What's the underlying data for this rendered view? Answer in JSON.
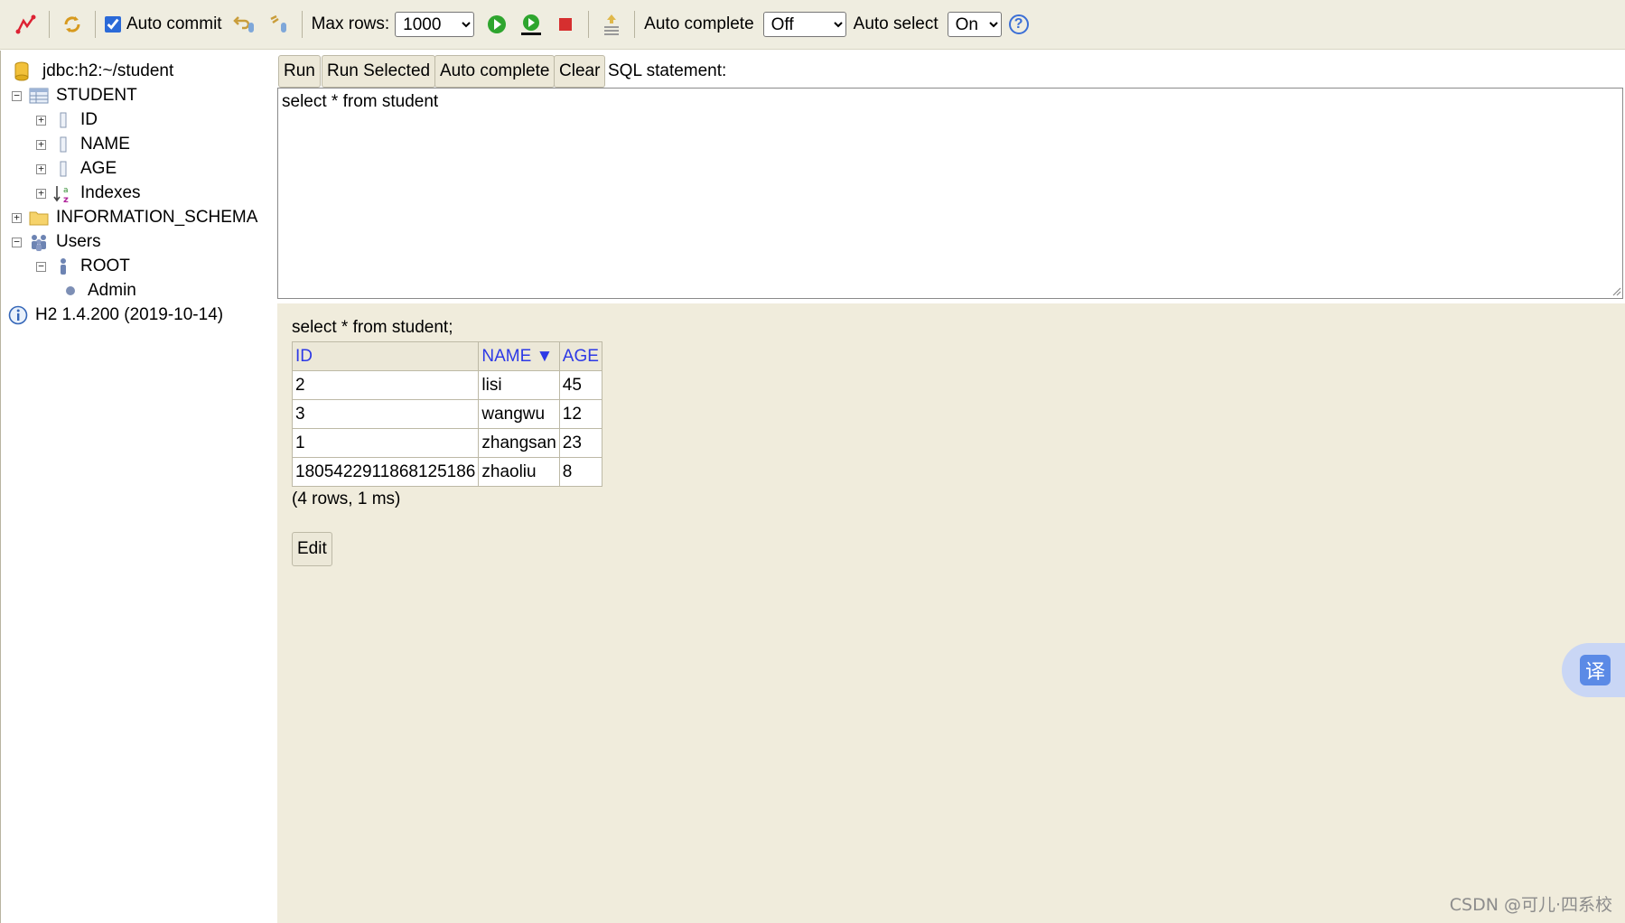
{
  "toolbar": {
    "auto_commit_label": "Auto commit",
    "auto_commit_checked": true,
    "max_rows_label": "Max rows:",
    "max_rows_value": "1000",
    "auto_complete_label": "Auto complete",
    "auto_complete_value": "Off",
    "auto_select_label": "Auto select",
    "auto_select_value": "On",
    "help_glyph": "?"
  },
  "tree": {
    "connection": "jdbc:h2:~/student",
    "table": "STUDENT",
    "columns": [
      "ID",
      "NAME",
      "AGE"
    ],
    "indexes": "Indexes",
    "schema": "INFORMATION_SCHEMA",
    "users": "Users",
    "user_root": "ROOT",
    "user_role": "Admin",
    "version": "H2 1.4.200 (2019-10-14)"
  },
  "sql_buttons": {
    "run": "Run",
    "run_selected": "Run Selected",
    "auto_complete": "Auto complete",
    "clear": "Clear",
    "statement_label": "SQL statement:"
  },
  "sql_text": "select * from student",
  "result": {
    "query": "select * from student;",
    "headers": [
      "ID",
      "NAME ▼",
      "AGE"
    ],
    "rows": [
      [
        "2",
        "lisi",
        "45"
      ],
      [
        "3",
        "wangwu",
        "12"
      ],
      [
        "1",
        "zhangsan",
        "23"
      ],
      [
        "1805422911868125186",
        "zhaoliu",
        "8"
      ]
    ],
    "status": "(4 rows, 1 ms)",
    "edit_label": "Edit"
  },
  "translate_glyph": "译",
  "watermark": "CSDN @可儿·四系校"
}
